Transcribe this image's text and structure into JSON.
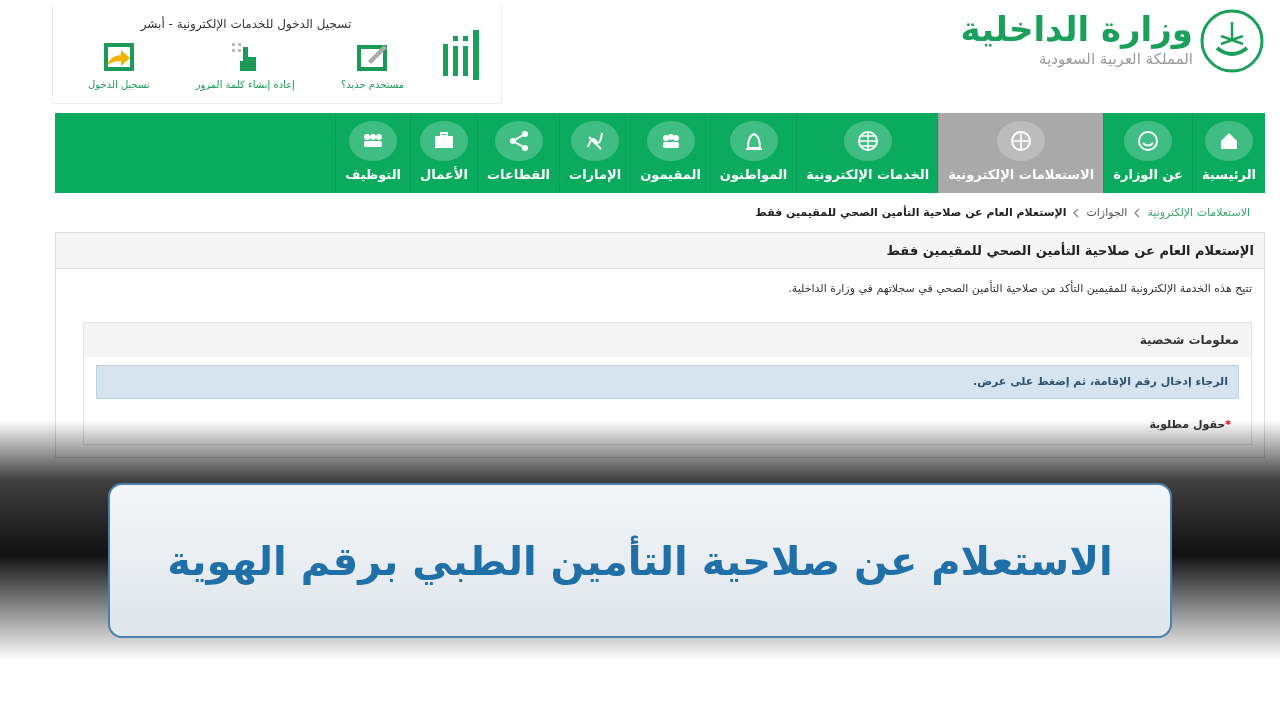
{
  "header": {
    "ministry_name": "وزارة الداخلية",
    "country": "المملكة العربية السعودية",
    "login_box": {
      "title": "تسجيل الدخول للخدمات الإلكترونية - أبشر",
      "links": [
        {
          "label": "مستخدم جديد؟",
          "kind": "new-user"
        },
        {
          "label": "إعادة إنشاء كلمة المرور",
          "kind": "reset"
        },
        {
          "label": "تسجيل الدخول",
          "kind": "login"
        }
      ]
    }
  },
  "nav": [
    {
      "label": "الرئيسية",
      "selected": false
    },
    {
      "label": "عن الوزارة",
      "selected": false
    },
    {
      "label": "الاستعلامات الإلكترونية",
      "selected": true
    },
    {
      "label": "الخدمات الإلكترونية",
      "selected": false
    },
    {
      "label": "المواطنون",
      "selected": false
    },
    {
      "label": "المقيمون",
      "selected": false
    },
    {
      "label": "الإمارات",
      "selected": false
    },
    {
      "label": "القطاعات",
      "selected": false
    },
    {
      "label": "الأعمال",
      "selected": false
    },
    {
      "label": "التوظيف",
      "selected": false
    }
  ],
  "breadcrumb": [
    {
      "label": "الاستعلامات الإلكترونية",
      "kind": "link"
    },
    {
      "label": "الجوازات",
      "kind": "plain"
    },
    {
      "label": "الإستعلام العام عن صلاحية التأمين الصحي للمقيمين فقط",
      "kind": "current"
    }
  ],
  "panel": {
    "title": "الإستعلام العام عن صلاحية التأمين الصحي للمقيمين فقط",
    "description": "تتيح هذه الخدمة الإلكترونية للمقيمين التأكد من صلاحية التأمين الصحي في سجلاتهم في وزارة الداخلية.",
    "section": {
      "title": "معلومات شخصية",
      "alert": "الرجاء إدخال رقم الإقامة، ثم إضغط على عرض.",
      "required_mark": "*",
      "required_note": "حقول مطلوبة"
    }
  },
  "banner": {
    "title": "الاستعلام عن صلاحية التأمين الطبي برقم الهوية"
  }
}
